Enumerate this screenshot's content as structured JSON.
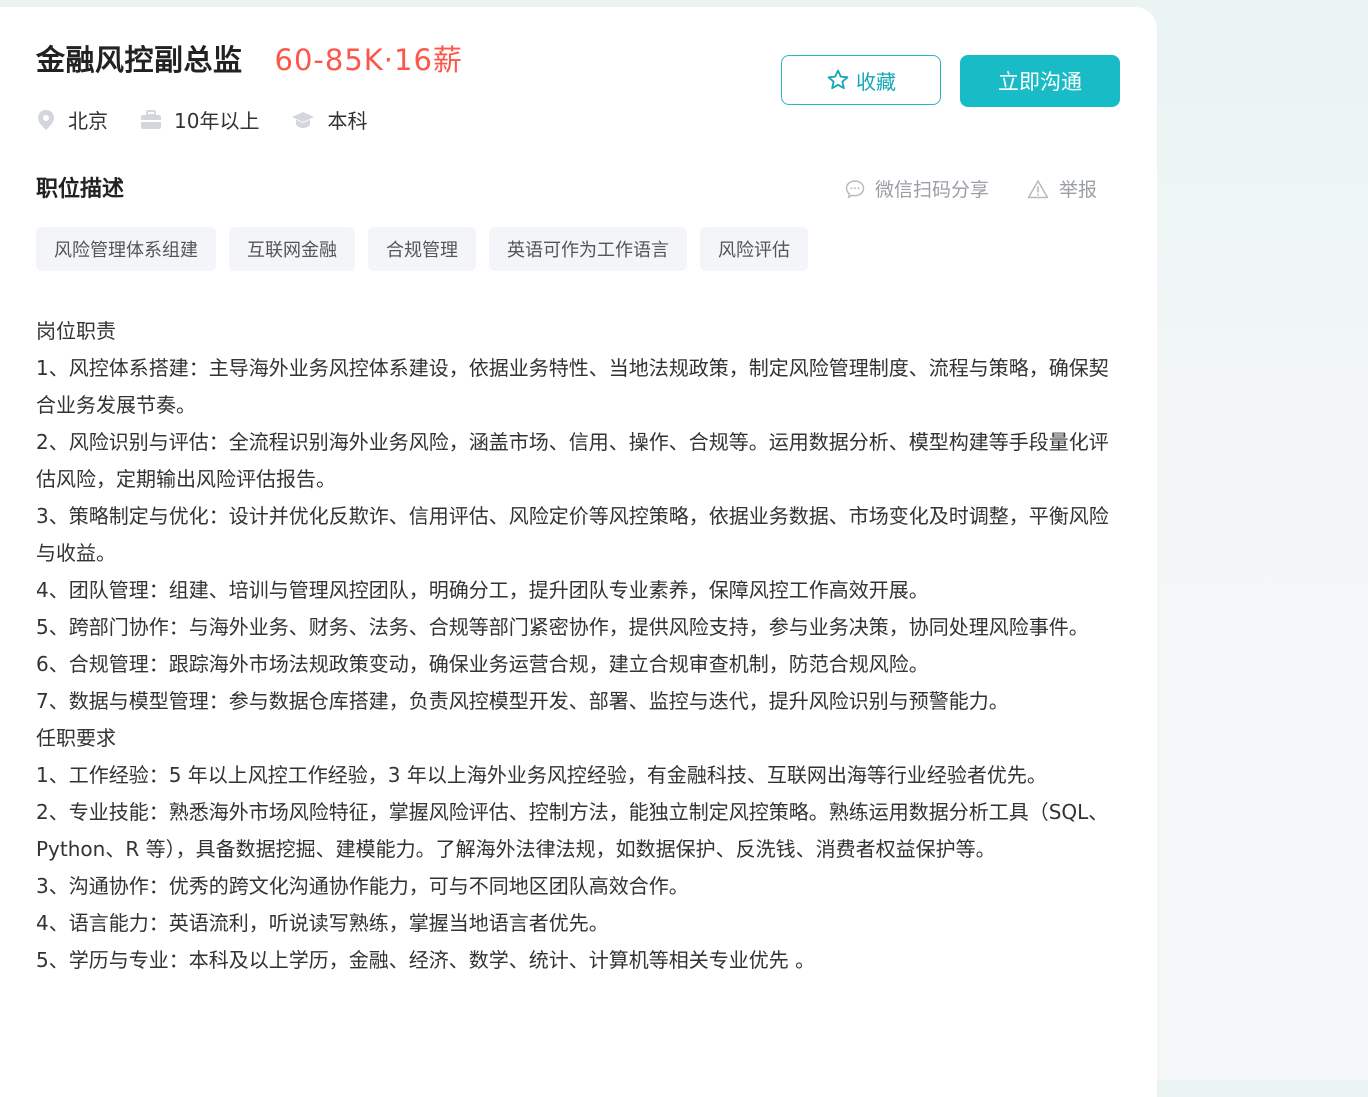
{
  "job": {
    "title": "金融风控副总监",
    "salary": "60-85K·16薪"
  },
  "meta": {
    "location": "北京",
    "experience": "10年以上",
    "education": "本科"
  },
  "buttons": {
    "favorite": "收藏",
    "chat": "立即沟通"
  },
  "section": {
    "title": "职位描述"
  },
  "aux": {
    "share": "微信扫码分享",
    "report": "举报"
  },
  "tags": [
    "风险管理体系组建",
    "互联网金融",
    "合规管理",
    "英语可作为工作语言",
    "风险评估"
  ],
  "description": {
    "duties_heading": "岗位职责",
    "duties": [
      "1、风控体系搭建：主导海外业务风控体系建设，依据业务特性、当地法规政策，制定风险管理制度、流程与策略，确保契合业务发展节奏。",
      "2、风险识别与评估：全流程识别海外业务风险，涵盖市场、信用、操作、合规等。运用数据分析、模型构建等手段量化评估风险，定期输出风险评估报告。",
      "3、策略制定与优化：设计并优化反欺诈、信用评估、风险定价等风控策略，依据业务数据、市场变化及时调整，平衡风险与收益。",
      "4、团队管理：组建、培训与管理风控团队，明确分工，提升团队专业素养，保障风控工作高效开展。",
      "5、跨部门协作：与海外业务、财务、法务、合规等部门紧密协作，提供风险支持，参与业务决策，协同处理风险事件。",
      "6、合规管理：跟踪海外市场法规政策变动，确保业务运营合规，建立合规审查机制，防范合规风险。",
      "7、数据与模型管理：参与数据仓库搭建，负责风控模型开发、部署、监控与迭代，提升风险识别与预警能力。"
    ],
    "req_heading": "任职要求",
    "requirements": [
      "1、工作经验：5 年以上风控工作经验，3 年以上海外业务风控经验，有金融科技、互联网出海等行业经验者优先。",
      "2、专业技能：熟悉海外市场风险特征，掌握风险评估、控制方法，能独立制定风控策略。熟练运用数据分析工具（SQL、Python、R 等），具备数据挖掘、建模能力。了解海外法律法规，如数据保护、反洗钱、消费者权益保护等。",
      "3、沟通协作：优秀的跨文化沟通协作能力，可与不同地区团队高效合作。",
      "4、语言能力：英语流利，听说读写熟练，掌握当地语言者优先。",
      "5、学历与专业：本科及以上学历，金融、经济、数学、统计、计算机等相关专业优先 。"
    ]
  }
}
